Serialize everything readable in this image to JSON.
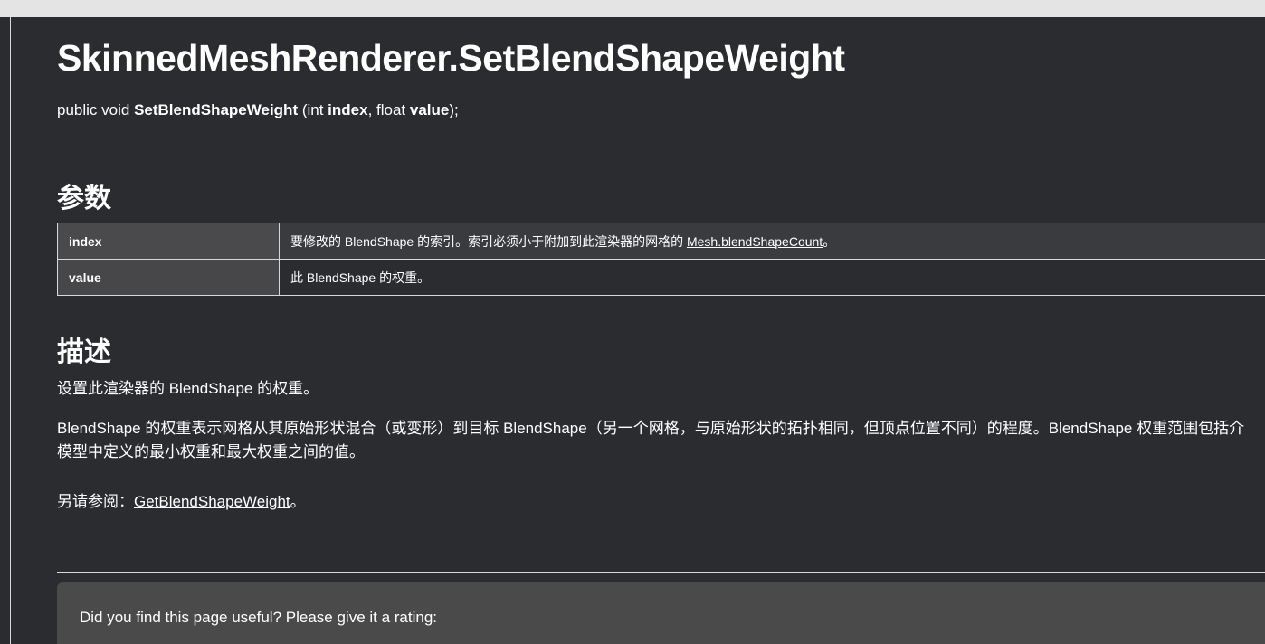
{
  "page": {
    "title": "SkinnedMeshRenderer.SetBlendShapeWeight",
    "signature": {
      "prefix": "public void ",
      "method": "SetBlendShapeWeight",
      "open": " (int ",
      "param1": "index",
      "sep": ", float ",
      "param2": "value",
      "close": ");"
    }
  },
  "parameters": {
    "heading": "参数",
    "rows": [
      {
        "name": "index",
        "desc_prefix": "要修改的 BlendShape 的索引。索引必须小于附加到此渲染器的网格的 ",
        "link": "Mesh.blendShapeCount",
        "desc_suffix": "。"
      },
      {
        "name": "value",
        "desc": "此 BlendShape 的权重。"
      }
    ]
  },
  "description": {
    "heading": "描述",
    "p1": "设置此渲染器的 BlendShape 的权重。",
    "p2_line1": "BlendShape 的权重表示网格从其原始形状混合（或变形）到目标 BlendShape（另一个网格，与原始形状的拓扑相同，但顶点位置不同）的程度。BlendShape 权重范围包括介",
    "p2_line2": "模型中定义的最小权重和最大权重之间的值。",
    "see_also_prefix": "另请参阅：",
    "see_also_link": "GetBlendShapeWeight",
    "see_also_suffix": "。"
  },
  "feedback": {
    "prompt": "Did you find this page useful? Please give it a rating:"
  }
}
